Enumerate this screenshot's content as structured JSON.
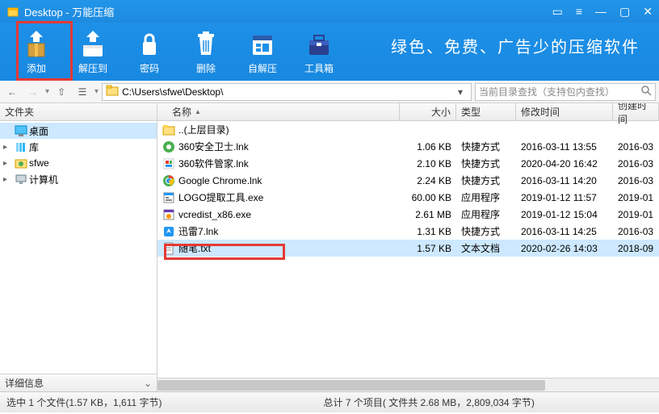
{
  "titlebar": {
    "title": "Desktop - 万能压缩"
  },
  "toolbar": {
    "add": "添加",
    "extract": "解压到",
    "password": "密码",
    "delete": "删除",
    "sfx": "自解压",
    "tools": "工具箱",
    "slogan": "绿色、免费、广告少的压缩软件"
  },
  "nav": {
    "path": "C:\\Users\\sfwe\\Desktop\\",
    "search_placeholder": "当前目录查找（支持包内查找）"
  },
  "sidebar": {
    "header": "文件夹",
    "items": [
      {
        "label": "桌面",
        "exp": ""
      },
      {
        "label": "库",
        "exp": "▸"
      },
      {
        "label": "sfwe",
        "exp": "▸"
      },
      {
        "label": "计算机",
        "exp": "▸"
      }
    ],
    "footer": "详细信息"
  },
  "columns": {
    "name": "名称",
    "size": "大小",
    "type": "类型",
    "mtime": "修改时间",
    "ctime": "创建时间"
  },
  "rows": [
    {
      "name": "..(上层目录)",
      "size": "",
      "type": "",
      "mtime": "",
      "ctime": "",
      "icon": "folder"
    },
    {
      "name": "360安全卫士.lnk",
      "size": "1.06 KB",
      "type": "快捷方式",
      "mtime": "2016-03-11 13:55",
      "ctime": "2016-03",
      "icon": "360"
    },
    {
      "name": "360软件管家.lnk",
      "size": "2.10 KB",
      "type": "快捷方式",
      "mtime": "2020-04-20 16:42",
      "ctime": "2016-03",
      "icon": "360m"
    },
    {
      "name": "Google Chrome.lnk",
      "size": "2.24 KB",
      "type": "快捷方式",
      "mtime": "2016-03-11 14:20",
      "ctime": "2016-03",
      "icon": "chrome"
    },
    {
      "name": "LOGO提取工具.exe",
      "size": "60.00 KB",
      "type": "应用程序",
      "mtime": "2019-01-12 11:57",
      "ctime": "2019-01",
      "icon": "exe"
    },
    {
      "name": "vcredist_x86.exe",
      "size": "2.61 MB",
      "type": "应用程序",
      "mtime": "2019-01-12 15:04",
      "ctime": "2019-01",
      "icon": "exe2"
    },
    {
      "name": "迅雷7.lnk",
      "size": "1.31 KB",
      "type": "快捷方式",
      "mtime": "2016-03-11 14:25",
      "ctime": "2016-03",
      "icon": "xl"
    },
    {
      "name": "随笔.txt",
      "size": "1.57 KB",
      "type": "文本文档",
      "mtime": "2020-02-26 14:03",
      "ctime": "2018-09",
      "icon": "txt",
      "selected": true
    }
  ],
  "status": {
    "selected": "选中 1 个文件(1.57 KB，1,611 字节)",
    "total": "总计 7 个项目( 文件共 2.68 MB，2,809,034 字节)"
  }
}
